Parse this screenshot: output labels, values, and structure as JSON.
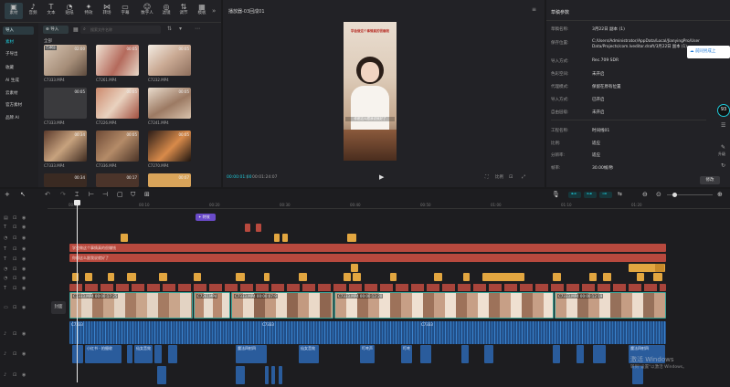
{
  "toolbar": {
    "items": [
      {
        "label": "素材",
        "icon": "import-icon"
      },
      {
        "label": "音频",
        "icon": "music-icon"
      },
      {
        "label": "文本",
        "icon": "text-icon"
      },
      {
        "label": "贴纸",
        "icon": "sticker-icon"
      },
      {
        "label": "特效",
        "icon": "effects-icon"
      },
      {
        "label": "转场",
        "icon": "transition-icon"
      },
      {
        "label": "字幕",
        "icon": "caption-icon"
      },
      {
        "label": "数字人",
        "icon": "avatar-icon"
      },
      {
        "label": "滤镜",
        "icon": "filter-icon"
      },
      {
        "label": "调节",
        "icon": "adjust-icon"
      },
      {
        "label": "模板",
        "icon": "template-icon"
      }
    ],
    "more": "»"
  },
  "sidebar": {
    "items": [
      {
        "label": "导入"
      },
      {
        "label": "素材"
      },
      {
        "label": "子导出"
      },
      {
        "label": "收藏"
      },
      {
        "label": "AI 生成"
      },
      {
        "label": "云素材"
      },
      {
        "label": "官方素材"
      },
      {
        "label": "品牌 AI"
      }
    ]
  },
  "media": {
    "import_label": "导入",
    "search_placeholder": "搜索文件名称",
    "section_label": "全部",
    "items": [
      {
        "name": "C7333.MP4",
        "duration": "02:00",
        "badge": "已添加"
      },
      {
        "name": "C7261.MP4",
        "duration": "00:05"
      },
      {
        "name": "C7232.MP4",
        "duration": "00:05"
      },
      {
        "name": "C7333.MP4",
        "duration": "00:05"
      },
      {
        "name": "C7226.MP4",
        "duration": "00:05"
      },
      {
        "name": "C7241.MP4",
        "duration": "00:05"
      },
      {
        "name": "C7333.MP4",
        "duration": "00:34"
      },
      {
        "name": "C7336.MP4",
        "duration": "00:05"
      },
      {
        "name": "C7270.MP4",
        "duration": "00:05"
      },
      {
        "name": "",
        "duration": "00:34"
      },
      {
        "name": "",
        "duration": "00:17"
      },
      {
        "name": "",
        "duration": "00:07"
      }
    ]
  },
  "player": {
    "title": "播放器-03回成01",
    "video_caption_top": "学会做这个事情真的很赚钱",
    "video_caption_bottom": "你都这么跟我说就好了",
    "current_time": "00:00:01:00",
    "total_time": "00:01:24:07",
    "ratio_label": "比例"
  },
  "details": {
    "title": "草稿参数",
    "rows": [
      {
        "label": "草稿名称:",
        "value": "3月22日 副本 (1)"
      },
      {
        "label": "保存位置:",
        "value": "C:/Users/Administrator/AppData/Local/JianyingPro/User Data/Projects/com.lveditor.draft/3月22日 副本 (1)"
      },
      {
        "label": "导入方式:",
        "value": "Rec.709 SDR"
      },
      {
        "label": "色彩空间:",
        "value": "未开启"
      },
      {
        "label": "代理模式:",
        "value": "保留在原有位置"
      },
      {
        "label": "导入方式:",
        "value": "已开启"
      },
      {
        "label": "自由层级:",
        "value": "未开启"
      },
      {
        "label": "工程名称:",
        "value": "时间线01"
      },
      {
        "label": "比例:",
        "value": "适应"
      },
      {
        "label": "分辨率:",
        "value": "适应"
      },
      {
        "label": "帧率:",
        "value": "30.00帧/秒"
      }
    ],
    "modify_button": "修改",
    "popup_text": "前同另成上"
  },
  "side_badges": {
    "score": "93",
    "upgrade": "升级"
  },
  "timeline": {
    "ticks": [
      "00:00",
      "00:10",
      "00:20",
      "00:30",
      "00:40",
      "00:50",
      "01:00",
      "01:10",
      "01:20"
    ],
    "cover_label": "封面",
    "effect_badge": "特效",
    "text_clips": [
      "学会做这个事情真的很赚钱",
      "你都这么跟我说就好了"
    ],
    "video_clips": [
      {
        "name": "C7333.MP4  00:00:17:25"
      },
      {
        "name": "C7261MP4"
      },
      {
        "name": "C7333.MP4  00:00:07:9"
      },
      {
        "name": "C7333.MP4  00:00:12:20"
      },
      {
        "name": "C7333.MP4  00:00:12:19"
      }
    ],
    "audio_main_labels": [
      "C7333",
      "C7333",
      "C7333"
    ],
    "audio_sfx": [
      {
        "name": "小红书 - 拍摄收"
      },
      {
        "name": "仙女音效"
      },
      {
        "name": "魔法四射四"
      },
      {
        "name": "仙女音效"
      },
      {
        "name": "叮咚声"
      },
      {
        "name": "叮咚"
      },
      {
        "name": "魔法四射四"
      }
    ]
  },
  "watermark": {
    "line1": "激活 Windows",
    "line2": "转到\"设置\"以激活 Windows。"
  },
  "colors": {
    "text_track": "#b8493e",
    "sticker_track": "#e2a640",
    "video_track": "#25706a",
    "audio_track": "#2a5c9c",
    "accent": "#1ec8d8"
  }
}
